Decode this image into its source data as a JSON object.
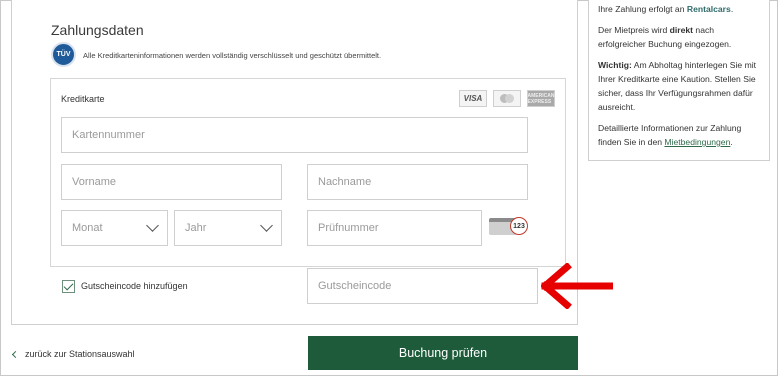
{
  "payment": {
    "title": "Zahlungsdaten",
    "tuv_badge": "TÜV",
    "secure_note": "Alle Kreditkarteninformationen werden vollständig verschlüsselt und geschützt übermittelt.",
    "card": {
      "label": "Kreditkarte",
      "logos": [
        "VISA",
        "Mastercard",
        "American Express"
      ],
      "amex_text": "AMERICAN EXPRESS",
      "number_placeholder": "Kartennummer",
      "firstname_placeholder": "Vorname",
      "lastname_placeholder": "Nachname",
      "month_placeholder": "Monat",
      "year_placeholder": "Jahr",
      "cvv_placeholder": "Prüfnummer",
      "cvv_icon_text": "123"
    },
    "voucher": {
      "checkbox_label": "Gutscheincode hinzufügen",
      "checked": true,
      "placeholder": "Gutscheincode"
    }
  },
  "footer": {
    "back_label": "zurück zur Stationsauswahl",
    "submit_label": "Buchung prüfen"
  },
  "info": {
    "p1_text": "Ihre Zahlung erfolgt an ",
    "p1_brand": "Rentalcars",
    "p1_end": ".",
    "p2_a": "Der Mietpreis wird ",
    "p2_bold": "direkt",
    "p2_b": " nach erfolgreicher Buchung eingezogen.",
    "p3_bold": "Wichtig:",
    "p3_text": " Am Abholtag hinterlegen Sie mit Ihrer Kreditkarte eine Kaution. Stellen Sie sicher, dass Ihr Verfügungsrahmen dafür ausreicht.",
    "p4_text": "Detaillierte Informationen zur Zahlung finden Sie in den ",
    "p4_link": "Mietbedingungen",
    "p4_end": "."
  },
  "colors": {
    "primary_green": "#1d5b3a",
    "annotation_arrow": "#e60000"
  }
}
